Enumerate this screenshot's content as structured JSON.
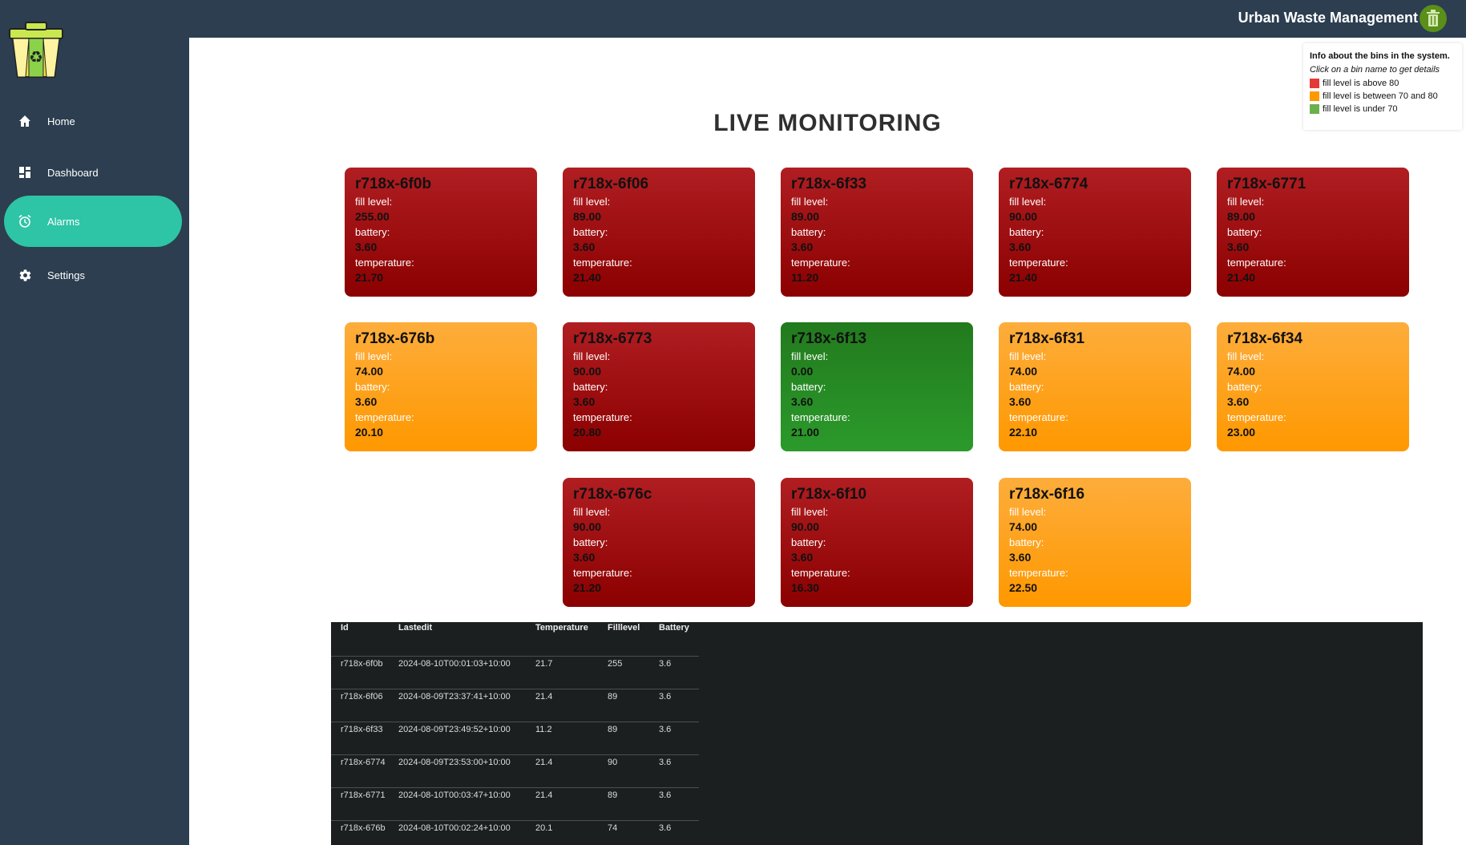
{
  "header": {
    "app_title": "Urban Waste Management"
  },
  "sidebar": {
    "items": [
      {
        "label": "Home",
        "icon": "home-icon"
      },
      {
        "label": "Dashboard",
        "icon": "dashboard-icon"
      },
      {
        "label": "Alarms",
        "icon": "alarm-icon",
        "active": true
      },
      {
        "label": "Settings",
        "icon": "gear-icon"
      }
    ]
  },
  "legend": {
    "title": "Info about the bins in the system.",
    "subtitle": "Click on a bin name to get details",
    "items": [
      {
        "label": "fill level is above 80",
        "color": "#e53935"
      },
      {
        "label": "fill level is between 70 and 80",
        "color": "#ff9800"
      },
      {
        "label": "fill level is under 70",
        "color": "#6ab04c"
      }
    ]
  },
  "main": {
    "title": "LIVE MONITORING"
  },
  "card_labels": {
    "fill": "fill level:",
    "battery": "battery:",
    "temperature": "temperature:"
  },
  "bins": [
    {
      "name": "r718x-6f0b",
      "fill": "255.00",
      "battery": "3.60",
      "temperature": "21.70",
      "status": "red"
    },
    {
      "name": "r718x-6f06",
      "fill": "89.00",
      "battery": "3.60",
      "temperature": "21.40",
      "status": "red"
    },
    {
      "name": "r718x-6f33",
      "fill": "89.00",
      "battery": "3.60",
      "temperature": "11.20",
      "status": "red"
    },
    {
      "name": "r718x-6774",
      "fill": "90.00",
      "battery": "3.60",
      "temperature": "21.40",
      "status": "red"
    },
    {
      "name": "r718x-6771",
      "fill": "89.00",
      "battery": "3.60",
      "temperature": "21.40",
      "status": "red"
    },
    {
      "name": "r718x-676b",
      "fill": "74.00",
      "battery": "3.60",
      "temperature": "20.10",
      "status": "orange"
    },
    {
      "name": "r718x-6773",
      "fill": "90.00",
      "battery": "3.60",
      "temperature": "20.80",
      "status": "red"
    },
    {
      "name": "r718x-6f13",
      "fill": "0.00",
      "battery": "3.60",
      "temperature": "21.00",
      "status": "green"
    },
    {
      "name": "r718x-6f31",
      "fill": "74.00",
      "battery": "3.60",
      "temperature": "22.10",
      "status": "orange"
    },
    {
      "name": "r718x-6f34",
      "fill": "74.00",
      "battery": "3.60",
      "temperature": "23.00",
      "status": "orange"
    },
    {
      "name": "r718x-676c",
      "fill": "90.00",
      "battery": "3.60",
      "temperature": "21.20",
      "status": "red"
    },
    {
      "name": "r718x-6f10",
      "fill": "90.00",
      "battery": "3.60",
      "temperature": "16.30",
      "status": "red"
    },
    {
      "name": "r718x-6f16",
      "fill": "74.00",
      "battery": "3.60",
      "temperature": "22.50",
      "status": "orange"
    }
  ],
  "table": {
    "headers": [
      "Id",
      "Lastedit",
      "Temperature",
      "Filllevel",
      "Battery"
    ],
    "rows": [
      [
        "r718x-6f0b",
        "2024-08-10T00:01:03+10:00",
        "21.7",
        "255",
        "3.6"
      ],
      [
        "r718x-6f06",
        "2024-08-09T23:37:41+10:00",
        "21.4",
        "89",
        "3.6"
      ],
      [
        "r718x-6f33",
        "2024-08-09T23:49:52+10:00",
        "11.2",
        "89",
        "3.6"
      ],
      [
        "r718x-6774",
        "2024-08-09T23:53:00+10:00",
        "21.4",
        "90",
        "3.6"
      ],
      [
        "r718x-6771",
        "2024-08-10T00:03:47+10:00",
        "21.4",
        "89",
        "3.6"
      ],
      [
        "r718x-676b",
        "2024-08-10T00:02:24+10:00",
        "20.1",
        "74",
        "3.6"
      ]
    ]
  }
}
